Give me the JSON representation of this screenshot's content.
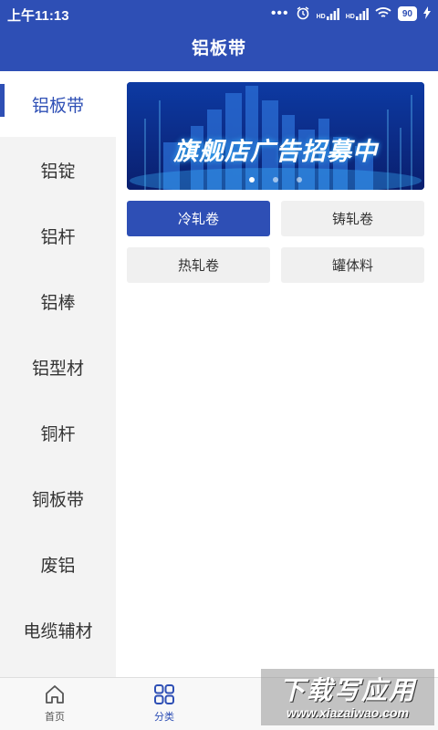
{
  "status_bar": {
    "time": "上午11:13",
    "signal_1_label": "HD",
    "signal_2_label": "HD",
    "battery": "90"
  },
  "header": {
    "title": "铝板带"
  },
  "sidebar": {
    "items": [
      {
        "label": "铝板带",
        "active": true
      },
      {
        "label": "铝锭"
      },
      {
        "label": "铝杆"
      },
      {
        "label": "铝棒"
      },
      {
        "label": "铝型材"
      },
      {
        "label": "铜杆"
      },
      {
        "label": "铜板带"
      },
      {
        "label": "废铝"
      },
      {
        "label": "电缆辅材"
      }
    ]
  },
  "banner": {
    "text": "旗舰店广告招募中",
    "pages": 3,
    "current_page": 1
  },
  "subcategories": [
    {
      "label": "冷轧卷",
      "active": true
    },
    {
      "label": "铸轧卷"
    },
    {
      "label": "热轧卷"
    },
    {
      "label": "罐体料"
    }
  ],
  "bottom_nav": {
    "items": [
      {
        "label": "首页",
        "icon": "home-icon"
      },
      {
        "label": "分类",
        "icon": "category-grid-icon",
        "active": true
      }
    ]
  },
  "watermark": {
    "title": "下载写应用",
    "url": "www.xiazaiwao.com"
  },
  "colors": {
    "primary": "#2e4fb5",
    "sidebar_bg": "#f3f3f3",
    "chip_bg": "#f0f0f0"
  }
}
